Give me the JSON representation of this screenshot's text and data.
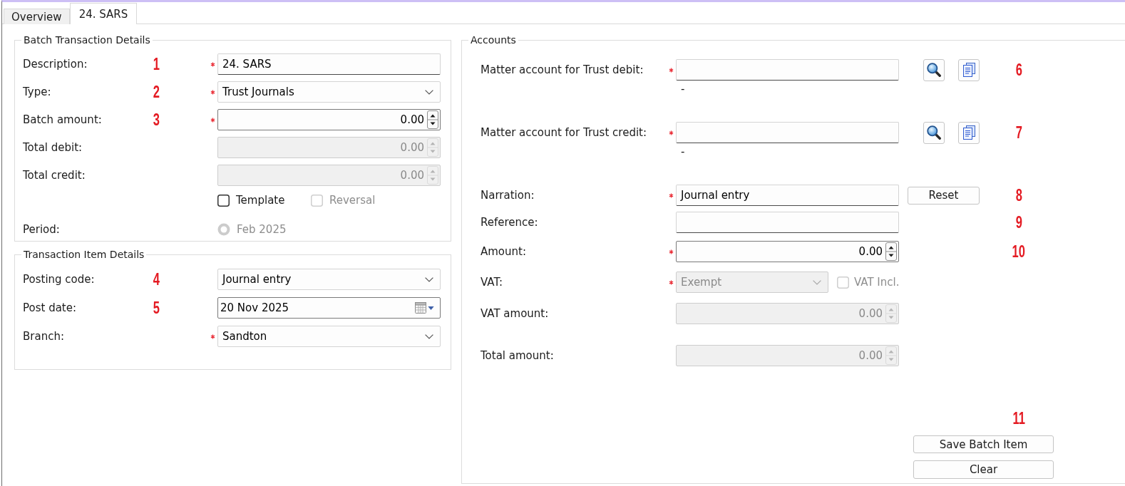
{
  "tabs": [
    {
      "label": "Overview",
      "selected": false
    },
    {
      "label": "24. SARS",
      "selected": true
    }
  ],
  "batch_details": {
    "title": "Batch Transaction Details",
    "fields": [
      {
        "kind": "text",
        "label": "Description:",
        "callout": "1",
        "required": true,
        "disabled": false,
        "value": "24. SARS"
      },
      {
        "kind": "select",
        "label": "Type:",
        "callout": "2",
        "required": true,
        "disabled": false,
        "value": "Trust Journals"
      },
      {
        "kind": "number",
        "label": "Batch amount:",
        "callout": "3",
        "required": true,
        "disabled": false,
        "value": "0.00"
      },
      {
        "kind": "number",
        "label": "Total debit:",
        "required": false,
        "disabled": true,
        "value": "0.00"
      },
      {
        "kind": "number",
        "label": "Total credit:",
        "required": false,
        "disabled": true,
        "value": "0.00"
      }
    ],
    "options": [
      {
        "label": "Template",
        "checked": false,
        "disabled": false
      },
      {
        "label": "Reversal",
        "checked": false,
        "disabled": true
      }
    ],
    "period": {
      "label": "Period:",
      "value": "Feb 2025",
      "disabled": true
    }
  },
  "item_details": {
    "title": "Transaction Item Details",
    "fields": [
      {
        "kind": "select",
        "label": "Posting code:",
        "callout": "4",
        "required": false,
        "disabled": false,
        "value": "Journal entry"
      },
      {
        "kind": "date",
        "label": "Post date:",
        "callout": "5",
        "required": false,
        "disabled": false,
        "value": "20 Nov 2025"
      },
      {
        "kind": "select",
        "label": "Branch:",
        "required": true,
        "disabled": false,
        "value": "Sandton"
      }
    ]
  },
  "accounts": {
    "title": "Accounts",
    "fields": [
      {
        "kind": "account",
        "label": "Matter account for Trust debit:",
        "required": true,
        "disabled": false,
        "account_name": "-",
        "callout": "6"
      },
      {
        "kind": "account",
        "label": "Matter account for Trust credit:",
        "required": true,
        "disabled": false,
        "account_name": "-",
        "callout": "7"
      },
      {
        "kind": "text",
        "label": "Narration:",
        "required": true,
        "disabled": false,
        "value": "Journal entry",
        "button": "Reset",
        "callout": "8"
      },
      {
        "kind": "text",
        "label": "Reference:",
        "required": false,
        "disabled": false,
        "callout": "9"
      },
      {
        "kind": "number",
        "label": "Amount:",
        "required": true,
        "disabled": false,
        "value": "0.00",
        "callout": "10"
      },
      {
        "kind": "select",
        "label": "VAT:",
        "required": true,
        "disabled": true,
        "value": "Exempt",
        "checkbox": {
          "label": "VAT Incl.",
          "checked": false,
          "disabled": true
        }
      },
      {
        "kind": "number",
        "label": "VAT amount:",
        "required": false,
        "disabled": true,
        "value": "0.00"
      },
      {
        "kind": "number",
        "label": "Total amount:",
        "required": false,
        "disabled": true,
        "value": "0.00"
      }
    ],
    "callout": "11",
    "buttons": [
      {
        "label": "Save Batch Item"
      },
      {
        "label": "Clear"
      }
    ]
  }
}
